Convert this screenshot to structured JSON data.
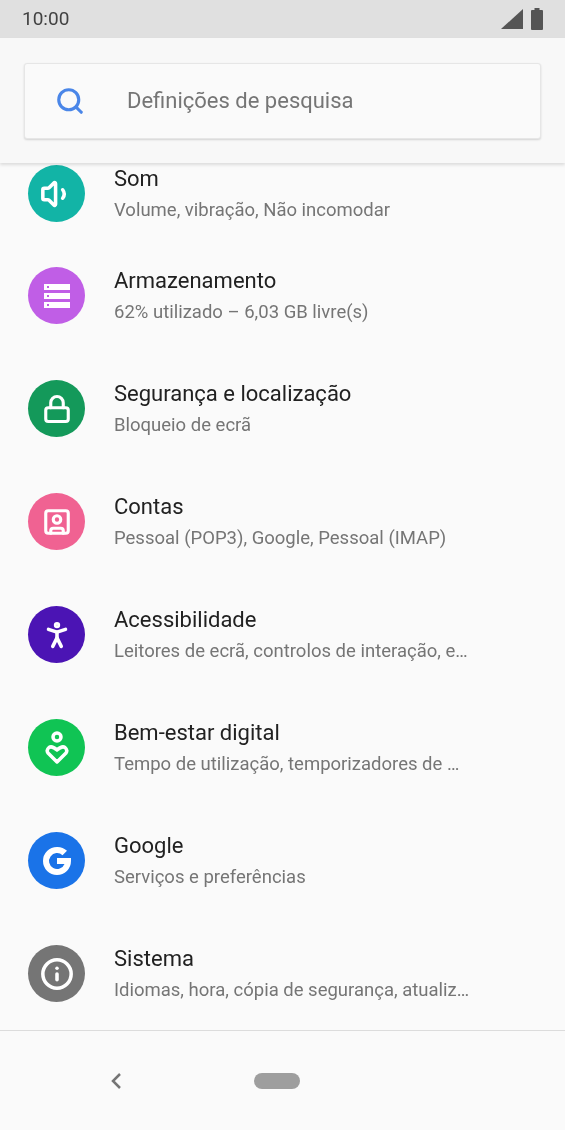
{
  "status_bar": {
    "time": "10:00"
  },
  "search": {
    "placeholder": "Definições de pesquisa"
  },
  "settings": [
    {
      "kind": "sound",
      "color": "#12b4a6",
      "title": "Som",
      "subtitle": "Volume, vibração, Não incomodar"
    },
    {
      "kind": "storage",
      "color": "#c05ee6",
      "title": "Armazenamento",
      "subtitle": "62% utilizado – 6,03 GB livre(s)"
    },
    {
      "kind": "security",
      "color": "#14995a",
      "title": "Segurança e localização",
      "subtitle": "Bloqueio de ecrã"
    },
    {
      "kind": "accounts",
      "color": "#f06292",
      "title": "Contas",
      "subtitle": "Pessoal (POP3), Google, Pessoal (IMAP)"
    },
    {
      "kind": "accessibility",
      "color": "#4b14b4",
      "title": "Acessibilidade",
      "subtitle": "Leitores de ecrã, controlos de interação, e…"
    },
    {
      "kind": "wellbeing",
      "color": "#10c454",
      "title": "Bem-estar digital",
      "subtitle": "Tempo de utilização, temporizadores de …"
    },
    {
      "kind": "google",
      "color": "#1a73e8",
      "title": "Google",
      "subtitle": "Serviços e preferências"
    },
    {
      "kind": "system",
      "color": "#757575",
      "title": "Sistema",
      "subtitle": "Idiomas, hora, cópia de segurança, atualiz…"
    }
  ]
}
